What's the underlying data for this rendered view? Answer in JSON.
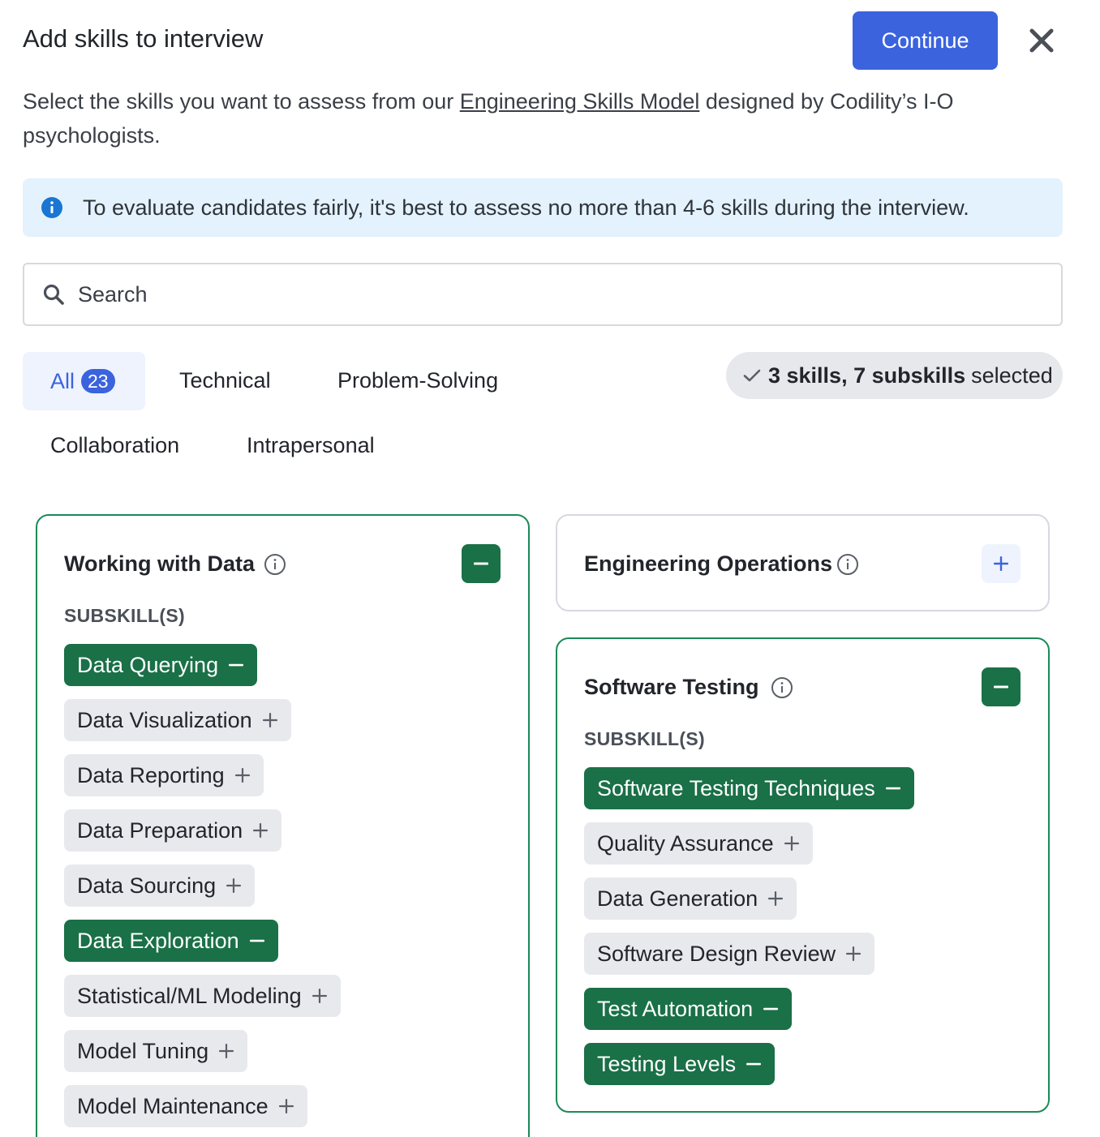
{
  "header": {
    "title": "Add skills to interview",
    "continue_label": "Continue"
  },
  "description": {
    "before": "Select the skills you want to assess from our ",
    "link": "Engineering Skills Model",
    "after": " designed by Codility’s I-O psychologists."
  },
  "banner": {
    "text": "To evaluate candidates fairly, it's best to assess no more than 4-6 skills during the interview."
  },
  "search": {
    "placeholder": "Search"
  },
  "tabs": [
    {
      "label": "All",
      "count": "23",
      "active": true
    },
    {
      "label": "Technical"
    },
    {
      "label": "Problem-Solving"
    },
    {
      "label": "Collaboration"
    },
    {
      "label": "Intrapersonal"
    }
  ],
  "selection_summary": {
    "bold": "3 skills, 7 subskills",
    "rest": "selected"
  },
  "cards": {
    "working_with_data": {
      "title": "Working with Data",
      "selected": true,
      "subskills_label": "SUBSKILL(S)",
      "subskills": [
        {
          "label": "Data Querying",
          "selected": true
        },
        {
          "label": "Data Visualization",
          "selected": false
        },
        {
          "label": "Data Reporting",
          "selected": false
        },
        {
          "label": "Data Preparation",
          "selected": false
        },
        {
          "label": "Data Sourcing",
          "selected": false
        },
        {
          "label": "Data Exploration",
          "selected": true
        },
        {
          "label": "Statistical/ML Modeling",
          "selected": false
        },
        {
          "label": "Model Tuning",
          "selected": false
        },
        {
          "label": "Model Maintenance",
          "selected": false
        }
      ]
    },
    "engineering_operations": {
      "title": "Engineering Operations",
      "selected": false
    },
    "software_testing": {
      "title": "Software Testing",
      "selected": true,
      "subskills_label": "SUBSKILL(S)",
      "subskills": [
        {
          "label": "Software Testing Techniques",
          "selected": true
        },
        {
          "label": "Quality Assurance",
          "selected": false
        },
        {
          "label": "Data Generation",
          "selected": false
        },
        {
          "label": "Software Design Review",
          "selected": false
        },
        {
          "label": "Test Automation",
          "selected": true
        },
        {
          "label": "Testing Levels",
          "selected": true
        }
      ]
    }
  },
  "colors": {
    "primary": "#3b63de",
    "selected_green": "#1a7047",
    "selected_border": "#1c8a57",
    "banner_bg": "#e3f2fd",
    "chip_off_bg": "#e8e9ed"
  }
}
